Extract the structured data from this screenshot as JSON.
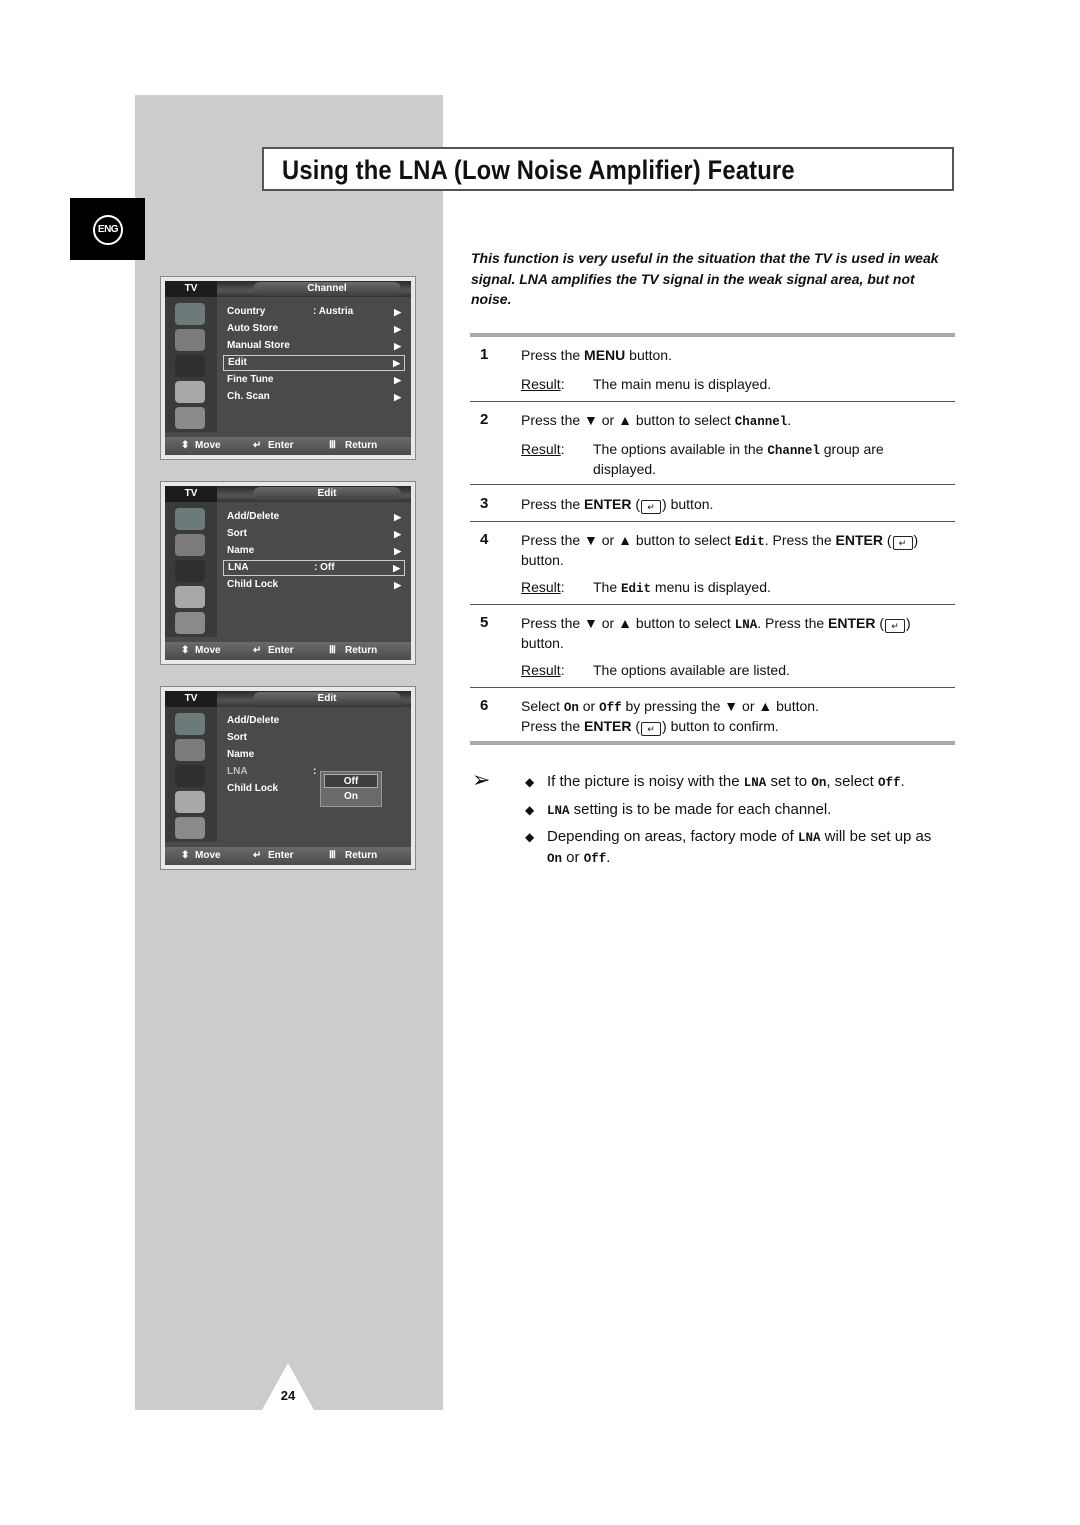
{
  "page": {
    "title": "Using the LNA (Low Noise Amplifier) Feature",
    "language_badge": "ENG",
    "page_number": "24"
  },
  "intro": "This function is very useful in the situation that the TV is used in weak signal. LNA amplifies the TV signal in the weak signal area, but not noise.",
  "osd_menus": [
    {
      "tv_label": "TV",
      "header": "Channel",
      "items": [
        {
          "label": "Country",
          "value": ": Austria",
          "arrow": "▶",
          "selected": false
        },
        {
          "label": "Auto Store",
          "value": "",
          "arrow": "▶",
          "selected": false
        },
        {
          "label": "Manual Store",
          "value": "",
          "arrow": "▶",
          "selected": false
        },
        {
          "label": "Edit",
          "value": "",
          "arrow": "▶",
          "selected": true
        },
        {
          "label": "Fine Tune",
          "value": "",
          "arrow": "▶",
          "selected": false
        },
        {
          "label": "Ch. Scan",
          "value": "",
          "arrow": "▶",
          "selected": false
        }
      ],
      "footer": {
        "move": "Move",
        "enter": "Enter",
        "return": "Return"
      }
    },
    {
      "tv_label": "TV",
      "header": "Edit",
      "items": [
        {
          "label": "Add/Delete",
          "value": "",
          "arrow": "▶",
          "selected": false
        },
        {
          "label": "Sort",
          "value": "",
          "arrow": "▶",
          "selected": false
        },
        {
          "label": "Name",
          "value": "",
          "arrow": "▶",
          "selected": false
        },
        {
          "label": "LNA",
          "value": ": Off",
          "arrow": "▶",
          "selected": true
        },
        {
          "label": "Child Lock",
          "value": "",
          "arrow": "▶",
          "selected": false
        }
      ],
      "footer": {
        "move": "Move",
        "enter": "Enter",
        "return": "Return"
      }
    },
    {
      "tv_label": "TV",
      "header": "Edit",
      "items": [
        {
          "label": "Add/Delete"
        },
        {
          "label": "Sort"
        },
        {
          "label": "Name"
        },
        {
          "label": "LNA",
          "value": ":"
        },
        {
          "label": "Child Lock"
        }
      ],
      "popup_options": [
        "Off",
        "On"
      ],
      "popup_selected": "Off",
      "footer": {
        "move": "Move",
        "enter": "Enter",
        "return": "Return"
      }
    }
  ],
  "steps": [
    {
      "num": "1",
      "text_parts": [
        "Press the ",
        "MENU",
        " button."
      ],
      "result_label": "Result",
      "result": "The main menu is displayed."
    },
    {
      "num": "2",
      "text_parts": [
        "Press the ▼ or ▲ button to select ",
        "Channel",
        "."
      ],
      "result_label": "Result",
      "result_parts": [
        "The options available in the ",
        "Channel",
        " group are displayed."
      ]
    },
    {
      "num": "3",
      "text_parts": [
        "Press the ",
        "ENTER",
        " (",
        ") button."
      ]
    },
    {
      "num": "4",
      "text_parts": [
        "Press the ▼ or ▲ button to select ",
        "Edit",
        ". Press the ",
        "ENTER",
        " (",
        ") button."
      ],
      "result_label": "Result",
      "result_parts": [
        "The ",
        "Edit",
        " menu is displayed."
      ]
    },
    {
      "num": "5",
      "text_parts": [
        "Press the ▼ or ▲ button to select ",
        "LNA",
        ". Press the ",
        "ENTER",
        " (",
        ") button."
      ],
      "result_label": "Result",
      "result": "The options available are listed."
    },
    {
      "num": "6",
      "text_parts": [
        "Select ",
        "On",
        " or ",
        "Off",
        " by pressing the ▼ or ▲ button.",
        "Press the ",
        "ENTER",
        " (",
        ") button to confirm."
      ]
    }
  ],
  "notes": [
    {
      "parts": [
        "If the picture is noisy with the ",
        "LNA",
        " set to ",
        "On",
        ", select ",
        "Off",
        "."
      ]
    },
    {
      "parts": [
        "LNA",
        " setting is to be made for each channel."
      ]
    },
    {
      "parts": [
        "Depending on areas, factory mode of ",
        "LNA",
        " will be set up as ",
        "On",
        " or ",
        "Off",
        "."
      ]
    }
  ],
  "glyphs": {
    "enter_icon": "↵",
    "note_arrow": "➢",
    "bullet": "◆",
    "updown": "⬍",
    "return_icon": "Ⅲ"
  }
}
